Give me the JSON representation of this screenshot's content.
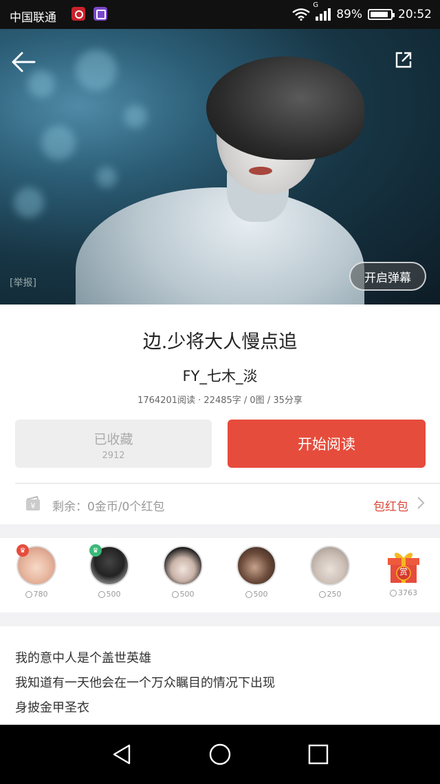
{
  "status_bar": {
    "carrier": "中国联通",
    "network": "G",
    "battery_percent": 89,
    "battery_text": "89%",
    "time": "20:52"
  },
  "hero": {
    "report_label": "[举报]",
    "danmaku_label": "开启弹幕"
  },
  "book": {
    "title": "边.少将大人慢点追",
    "author": "FY_七木_淡",
    "stats": "1764201阅读 · 22485字 / 0图 / 35分享"
  },
  "actions": {
    "favorite_label": "已收藏",
    "favorite_count": "2912",
    "read_label": "开始阅读"
  },
  "balance": {
    "text": "剩余：0金币/0个红包",
    "hongbao_label": "包红包"
  },
  "supporters": [
    {
      "amount": "780",
      "badge": "crown",
      "badge_color": "#e64c3c"
    },
    {
      "amount": "500",
      "badge": "crown",
      "badge_color": "#3cb878"
    },
    {
      "amount": "500"
    },
    {
      "amount": "500"
    },
    {
      "amount": "250"
    },
    {
      "amount": "3763",
      "gift_label": "赏"
    }
  ],
  "description": [
    "我的意中人是个盖世英雄",
    "我知道有一天他会在一个万众瞩目的情况下出现",
    "身披金甲圣衣"
  ],
  "colors": {
    "accent": "#e64c3c",
    "hongbao": "#d9473a"
  }
}
